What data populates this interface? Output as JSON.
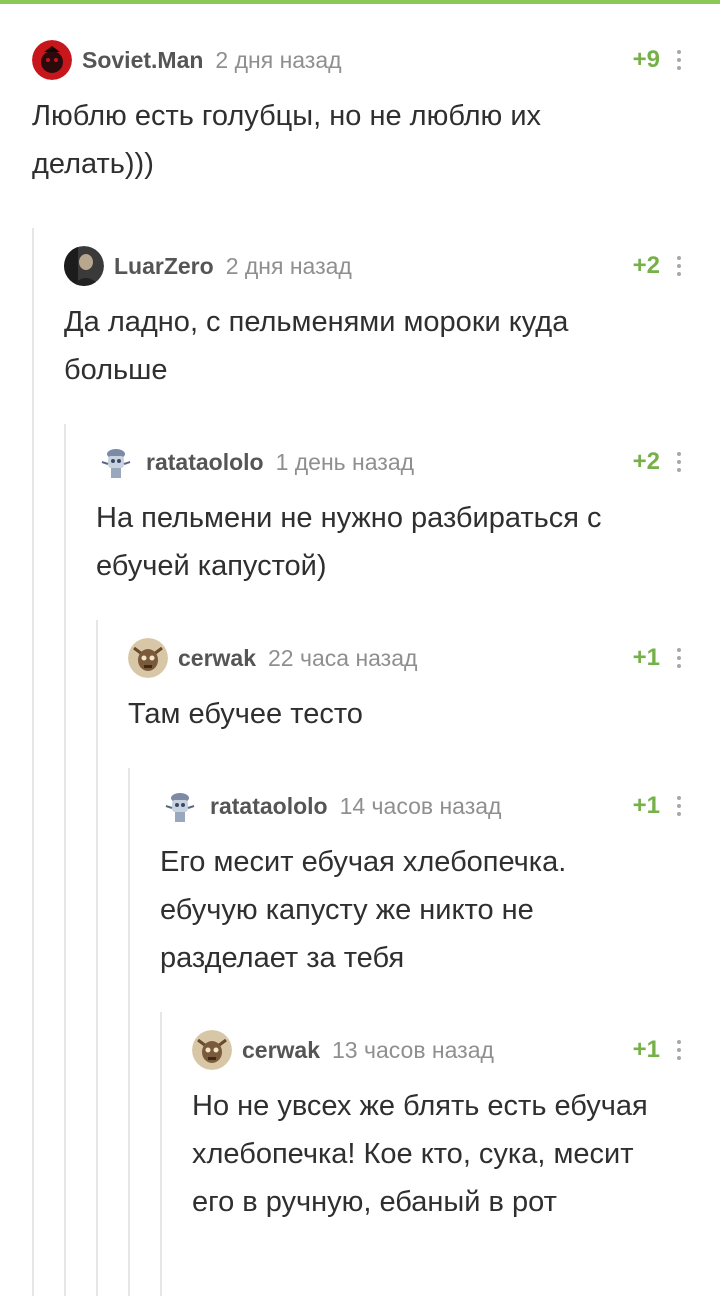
{
  "comments": [
    {
      "username": "Soviet.Man",
      "time": "2 дня назад",
      "rating": "+9",
      "text": "Люблю есть голубцы, но не люблю их делать)))",
      "avatar_icon": "soviet-avatar-icon"
    },
    {
      "username": "LuarZero",
      "time": "2 дня назад",
      "rating": "+2",
      "text": "Да ладно, с пельменями мороки куда больше",
      "avatar_icon": "portrait-avatar-icon"
    },
    {
      "username": "ratataololo",
      "time": "1 день назад",
      "rating": "+2",
      "text": "На пельмени не нужно разбираться с ебучей капустой)",
      "avatar_icon": "robot-avatar-icon"
    },
    {
      "username": "cerwak",
      "time": "22 часа назад",
      "rating": "+1",
      "text": "Там ебучее тесто",
      "avatar_icon": "creature-avatar-icon"
    },
    {
      "username": "ratataololo",
      "time": "14 часов назад",
      "rating": "+1",
      "text": "Его месит ебучая хлебопечка. ебучую капусту же никто не разделает за тебя",
      "avatar_icon": "robot-avatar-icon"
    },
    {
      "username": "cerwak",
      "time": "13 часов назад",
      "rating": "+1",
      "text": "Но не увсех же блять есть ебучая хлебопечка! Кое кто, сука, месит его в ручную, ебаный в рот",
      "avatar_icon": "creature-avatar-icon"
    }
  ],
  "colors": {
    "accent": "#8ac858",
    "rating": "#76b048",
    "username": "#555555",
    "time": "#8f8f8f",
    "thread_line": "#e6e6e6"
  }
}
